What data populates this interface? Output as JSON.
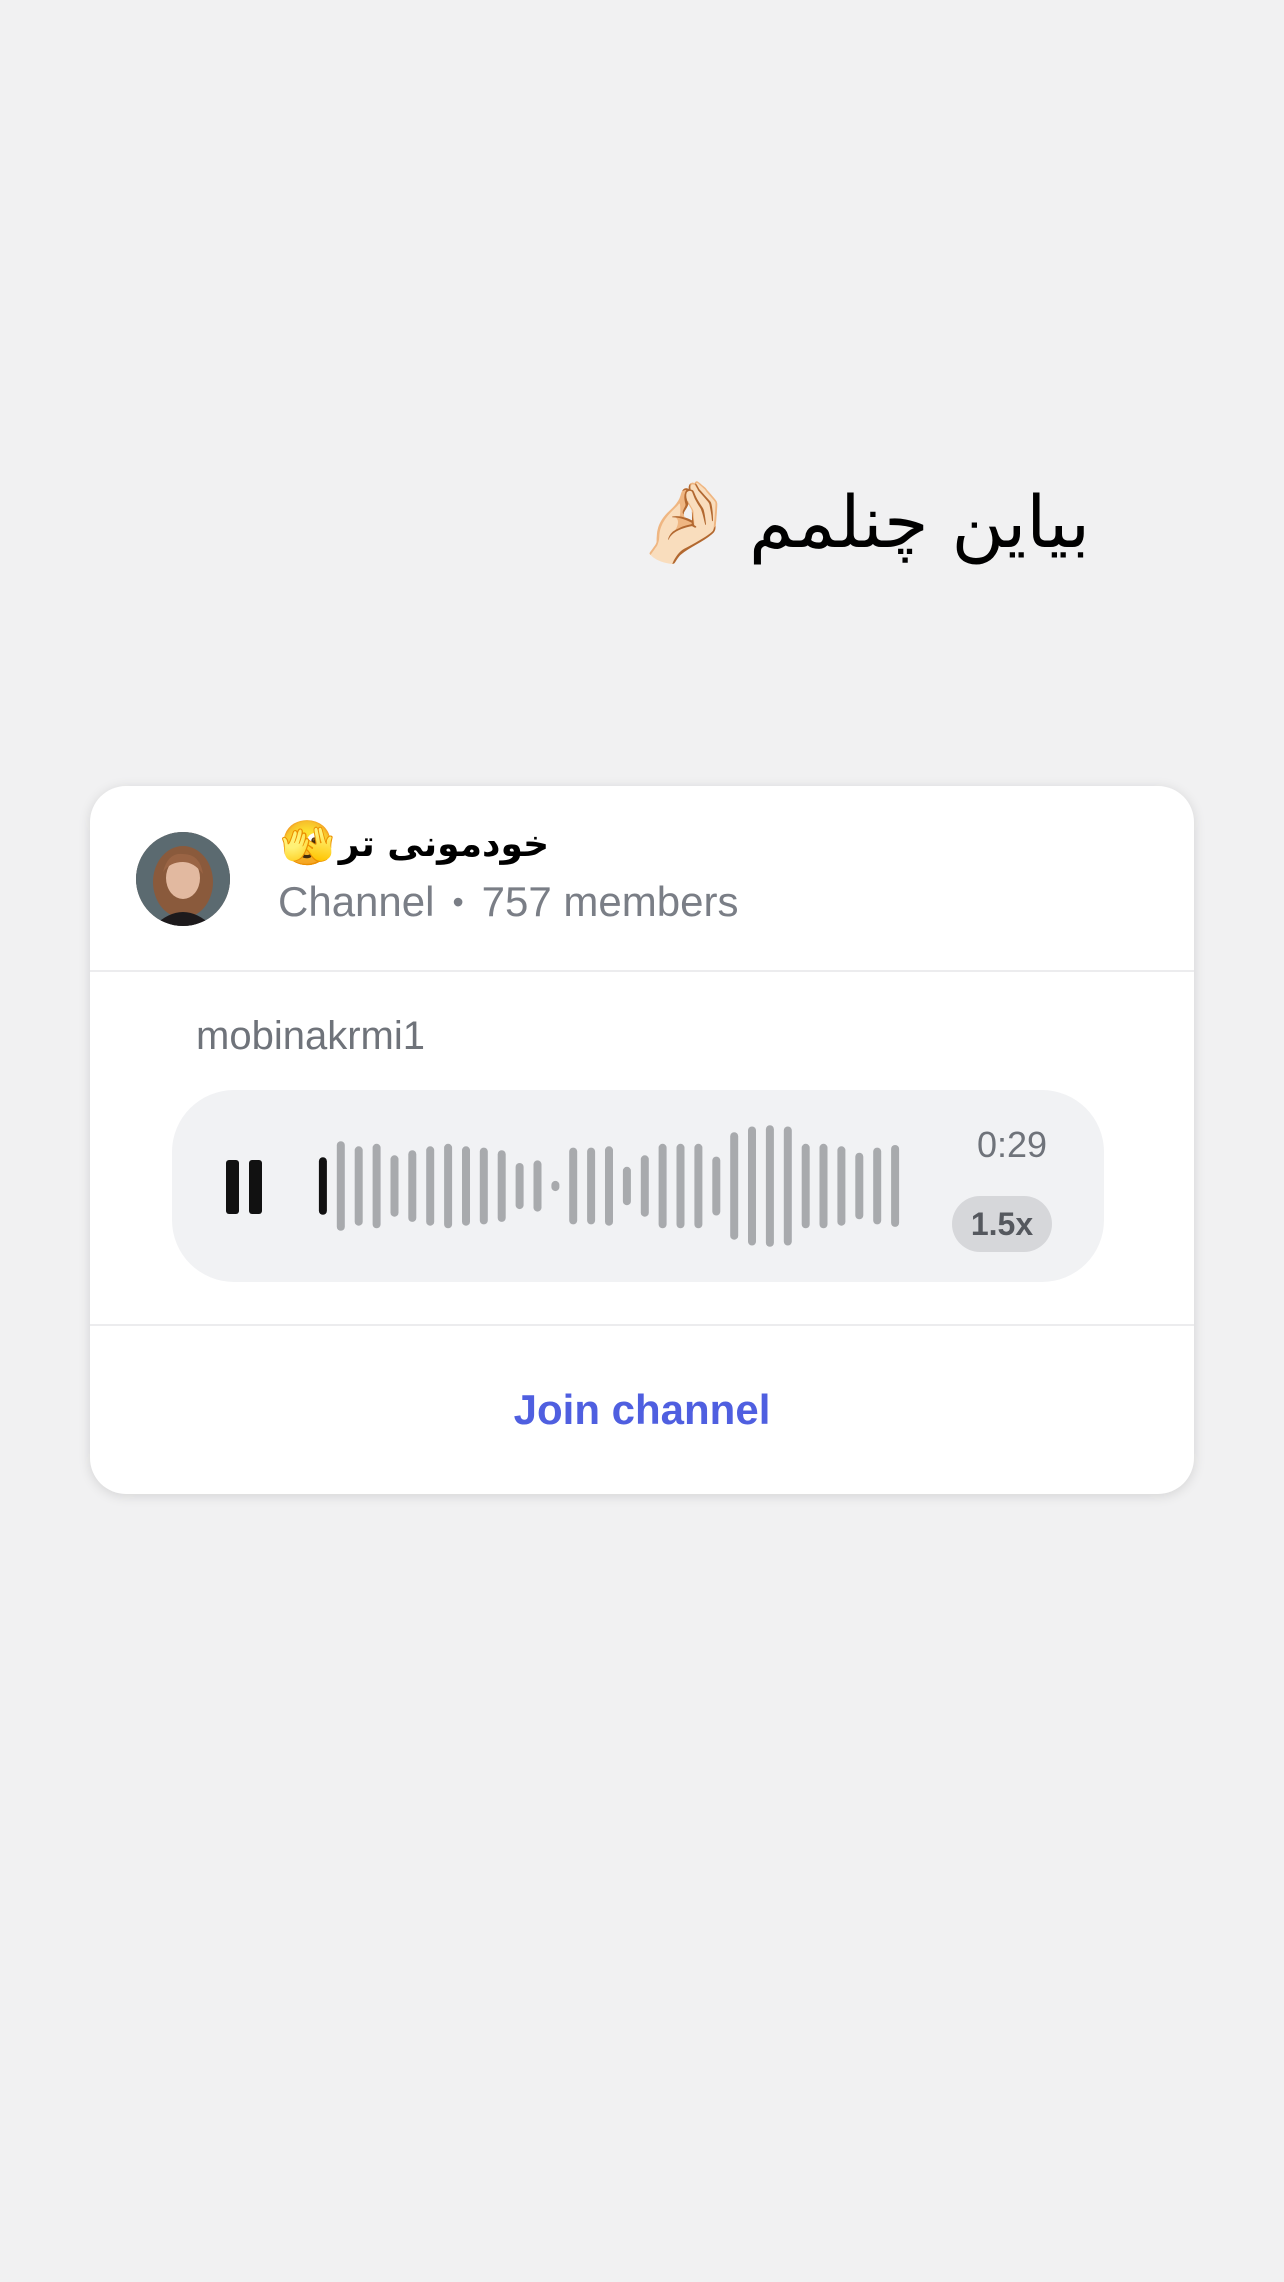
{
  "caption": {
    "text": "بیاین چنلمم",
    "emoji": "🤌🏻"
  },
  "channel": {
    "name": "خودمونی تر",
    "emoji": "🫣",
    "type_label": "Channel",
    "separator": "•",
    "members": "757 members",
    "avatar_icon": "profile-photo"
  },
  "post": {
    "author": "mobinakrmi1"
  },
  "voice": {
    "duration": "0:29",
    "speed": "1.5x",
    "state_icon": "pause-icon",
    "progress": 0.04,
    "played_color": "#111111",
    "unplayed_color": "#a8aaad",
    "levels": [
      0.45,
      0.7,
      0.62,
      0.66,
      0.48,
      0.56,
      0.62,
      0.66,
      0.62,
      0.6,
      0.56,
      0.36,
      0.4,
      0.08,
      0.6,
      0.6,
      0.62,
      0.3,
      0.48,
      0.66,
      0.66,
      0.66,
      0.46,
      0.84,
      0.93,
      0.95,
      0.93,
      0.66,
      0.66,
      0.62,
      0.52,
      0.6,
      0.64
    ]
  },
  "actions": {
    "join_label": "Join channel",
    "accent": "#4f5fe0"
  }
}
